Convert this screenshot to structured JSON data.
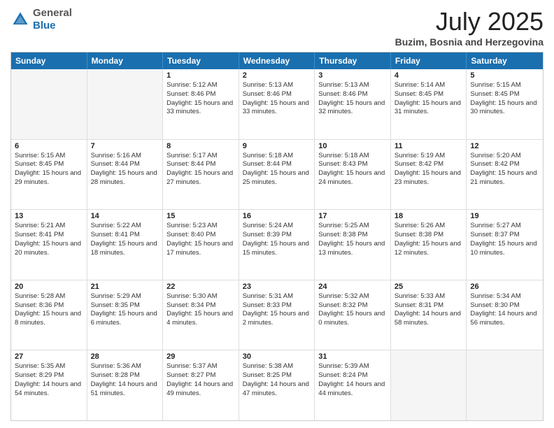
{
  "header": {
    "logo_general": "General",
    "logo_blue": "Blue",
    "month_title": "July 2025",
    "location": "Buzim, Bosnia and Herzegovina"
  },
  "weekdays": [
    "Sunday",
    "Monday",
    "Tuesday",
    "Wednesday",
    "Thursday",
    "Friday",
    "Saturday"
  ],
  "weeks": [
    [
      {
        "day": "",
        "sunrise": "",
        "sunset": "",
        "daylight": "",
        "empty": true
      },
      {
        "day": "",
        "sunrise": "",
        "sunset": "",
        "daylight": "",
        "empty": true
      },
      {
        "day": "1",
        "sunrise": "Sunrise: 5:12 AM",
        "sunset": "Sunset: 8:46 PM",
        "daylight": "Daylight: 15 hours and 33 minutes.",
        "empty": false
      },
      {
        "day": "2",
        "sunrise": "Sunrise: 5:13 AM",
        "sunset": "Sunset: 8:46 PM",
        "daylight": "Daylight: 15 hours and 33 minutes.",
        "empty": false
      },
      {
        "day": "3",
        "sunrise": "Sunrise: 5:13 AM",
        "sunset": "Sunset: 8:46 PM",
        "daylight": "Daylight: 15 hours and 32 minutes.",
        "empty": false
      },
      {
        "day": "4",
        "sunrise": "Sunrise: 5:14 AM",
        "sunset": "Sunset: 8:45 PM",
        "daylight": "Daylight: 15 hours and 31 minutes.",
        "empty": false
      },
      {
        "day": "5",
        "sunrise": "Sunrise: 5:15 AM",
        "sunset": "Sunset: 8:45 PM",
        "daylight": "Daylight: 15 hours and 30 minutes.",
        "empty": false
      }
    ],
    [
      {
        "day": "6",
        "sunrise": "Sunrise: 5:15 AM",
        "sunset": "Sunset: 8:45 PM",
        "daylight": "Daylight: 15 hours and 29 minutes.",
        "empty": false
      },
      {
        "day": "7",
        "sunrise": "Sunrise: 5:16 AM",
        "sunset": "Sunset: 8:44 PM",
        "daylight": "Daylight: 15 hours and 28 minutes.",
        "empty": false
      },
      {
        "day": "8",
        "sunrise": "Sunrise: 5:17 AM",
        "sunset": "Sunset: 8:44 PM",
        "daylight": "Daylight: 15 hours and 27 minutes.",
        "empty": false
      },
      {
        "day": "9",
        "sunrise": "Sunrise: 5:18 AM",
        "sunset": "Sunset: 8:44 PM",
        "daylight": "Daylight: 15 hours and 25 minutes.",
        "empty": false
      },
      {
        "day": "10",
        "sunrise": "Sunrise: 5:18 AM",
        "sunset": "Sunset: 8:43 PM",
        "daylight": "Daylight: 15 hours and 24 minutes.",
        "empty": false
      },
      {
        "day": "11",
        "sunrise": "Sunrise: 5:19 AM",
        "sunset": "Sunset: 8:42 PM",
        "daylight": "Daylight: 15 hours and 23 minutes.",
        "empty": false
      },
      {
        "day": "12",
        "sunrise": "Sunrise: 5:20 AM",
        "sunset": "Sunset: 8:42 PM",
        "daylight": "Daylight: 15 hours and 21 minutes.",
        "empty": false
      }
    ],
    [
      {
        "day": "13",
        "sunrise": "Sunrise: 5:21 AM",
        "sunset": "Sunset: 8:41 PM",
        "daylight": "Daylight: 15 hours and 20 minutes.",
        "empty": false
      },
      {
        "day": "14",
        "sunrise": "Sunrise: 5:22 AM",
        "sunset": "Sunset: 8:41 PM",
        "daylight": "Daylight: 15 hours and 18 minutes.",
        "empty": false
      },
      {
        "day": "15",
        "sunrise": "Sunrise: 5:23 AM",
        "sunset": "Sunset: 8:40 PM",
        "daylight": "Daylight: 15 hours and 17 minutes.",
        "empty": false
      },
      {
        "day": "16",
        "sunrise": "Sunrise: 5:24 AM",
        "sunset": "Sunset: 8:39 PM",
        "daylight": "Daylight: 15 hours and 15 minutes.",
        "empty": false
      },
      {
        "day": "17",
        "sunrise": "Sunrise: 5:25 AM",
        "sunset": "Sunset: 8:38 PM",
        "daylight": "Daylight: 15 hours and 13 minutes.",
        "empty": false
      },
      {
        "day": "18",
        "sunrise": "Sunrise: 5:26 AM",
        "sunset": "Sunset: 8:38 PM",
        "daylight": "Daylight: 15 hours and 12 minutes.",
        "empty": false
      },
      {
        "day": "19",
        "sunrise": "Sunrise: 5:27 AM",
        "sunset": "Sunset: 8:37 PM",
        "daylight": "Daylight: 15 hours and 10 minutes.",
        "empty": false
      }
    ],
    [
      {
        "day": "20",
        "sunrise": "Sunrise: 5:28 AM",
        "sunset": "Sunset: 8:36 PM",
        "daylight": "Daylight: 15 hours and 8 minutes.",
        "empty": false
      },
      {
        "day": "21",
        "sunrise": "Sunrise: 5:29 AM",
        "sunset": "Sunset: 8:35 PM",
        "daylight": "Daylight: 15 hours and 6 minutes.",
        "empty": false
      },
      {
        "day": "22",
        "sunrise": "Sunrise: 5:30 AM",
        "sunset": "Sunset: 8:34 PM",
        "daylight": "Daylight: 15 hours and 4 minutes.",
        "empty": false
      },
      {
        "day": "23",
        "sunrise": "Sunrise: 5:31 AM",
        "sunset": "Sunset: 8:33 PM",
        "daylight": "Daylight: 15 hours and 2 minutes.",
        "empty": false
      },
      {
        "day": "24",
        "sunrise": "Sunrise: 5:32 AM",
        "sunset": "Sunset: 8:32 PM",
        "daylight": "Daylight: 15 hours and 0 minutes.",
        "empty": false
      },
      {
        "day": "25",
        "sunrise": "Sunrise: 5:33 AM",
        "sunset": "Sunset: 8:31 PM",
        "daylight": "Daylight: 14 hours and 58 minutes.",
        "empty": false
      },
      {
        "day": "26",
        "sunrise": "Sunrise: 5:34 AM",
        "sunset": "Sunset: 8:30 PM",
        "daylight": "Daylight: 14 hours and 56 minutes.",
        "empty": false
      }
    ],
    [
      {
        "day": "27",
        "sunrise": "Sunrise: 5:35 AM",
        "sunset": "Sunset: 8:29 PM",
        "daylight": "Daylight: 14 hours and 54 minutes.",
        "empty": false
      },
      {
        "day": "28",
        "sunrise": "Sunrise: 5:36 AM",
        "sunset": "Sunset: 8:28 PM",
        "daylight": "Daylight: 14 hours and 51 minutes.",
        "empty": false
      },
      {
        "day": "29",
        "sunrise": "Sunrise: 5:37 AM",
        "sunset": "Sunset: 8:27 PM",
        "daylight": "Daylight: 14 hours and 49 minutes.",
        "empty": false
      },
      {
        "day": "30",
        "sunrise": "Sunrise: 5:38 AM",
        "sunset": "Sunset: 8:25 PM",
        "daylight": "Daylight: 14 hours and 47 minutes.",
        "empty": false
      },
      {
        "day": "31",
        "sunrise": "Sunrise: 5:39 AM",
        "sunset": "Sunset: 8:24 PM",
        "daylight": "Daylight: 14 hours and 44 minutes.",
        "empty": false
      },
      {
        "day": "",
        "sunrise": "",
        "sunset": "",
        "daylight": "",
        "empty": true
      },
      {
        "day": "",
        "sunrise": "",
        "sunset": "",
        "daylight": "",
        "empty": true
      }
    ]
  ]
}
